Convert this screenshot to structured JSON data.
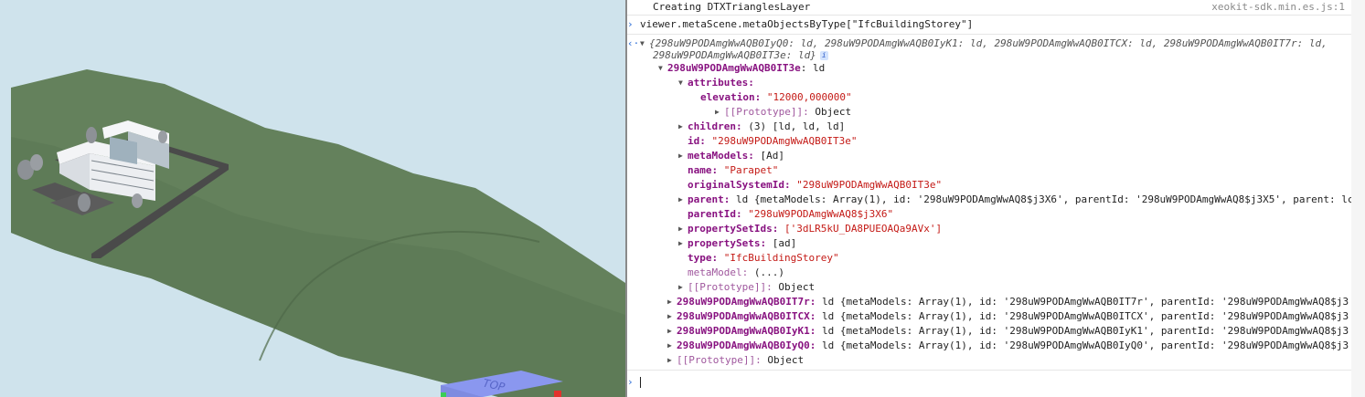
{
  "viewer": {
    "navcube_face_label": "TOP",
    "colors": {
      "sky": "#cfe3ec",
      "terrain": "#64815c",
      "road": "#4a4a4a",
      "building": "#e9ebee",
      "navcube": "#8a97ef"
    }
  },
  "console": {
    "lines": {
      "l0": "Creating DTXTrianglesLayer",
      "l0_src": "xeokit-sdk.min.es.js:1",
      "l1": "viewer.metaScene.metaObjectsByType[\"IfcBuildingStorey\"]",
      "l2a": "{298uW9PODAmgWwAQB0IyQ0: ld, 298uW9PODAmgWwAQB0IyK1: ld, 298uW9PODAmgWwAQB0ITCX: ld, 298uW9PODAmgWwAQB0IT7r: ld,",
      "l2b": "298uW9PODAmgWwAQB0IT3e: ld}",
      "badge": "i",
      "l3_key": "298uW9PODAmgWwAQB0IT3e",
      "l3_val": ": ld",
      "attributes": "attributes:",
      "elevation_key": "elevation:",
      "elevation_val": "\"12000,000000\"",
      "proto1_key": "[[Prototype]]:",
      "proto1_val": " Object",
      "children_key": "children:",
      "children_val": " (3) [ld, ld, ld]",
      "id_key": "id:",
      "id_val": " \"298uW9PODAmgWwAQB0IT3e\"",
      "metaModels_key": "metaModels:",
      "metaModels_val": " [Ad]",
      "name_key": "name:",
      "name_val": " \"Parapet\"",
      "osid_key": "originalSystemId:",
      "osid_val": " \"298uW9PODAmgWwAQB0IT3e\"",
      "parent_key": "parent:",
      "parent_val": " ld {metaModels: Array(1), id: '298uW9PODAmgWwAQ8$j3X6', parentId: '298uW9PODAmgWwAQ8$j3X5', parent: lc",
      "parentId_key": "parentId:",
      "parentId_val": " \"298uW9PODAmgWwAQ8$j3X6\"",
      "psIds_key": "propertySetIds:",
      "psIds_val": " ['3dLR5kU_DA8PUEOAQa9AVx']",
      "ps_key": "propertySets:",
      "ps_val": " [ad]",
      "type_key": "type:",
      "type_val": " \"IfcBuildingStorey\"",
      "metaModel_key": "metaModel:",
      "metaModel_val": " (...)",
      "proto2_key": "[[Prototype]]:",
      "proto2_val": " Object",
      "r1_key": "298uW9PODAmgWwAQB0IT7r:",
      "r1_val": " ld {metaModels: Array(1), id: '298uW9PODAmgWwAQB0IT7r', parentId: '298uW9PODAmgWwAQ8$j3",
      "r2_key": "298uW9PODAmgWwAQB0ITCX:",
      "r2_val": " ld {metaModels: Array(1), id: '298uW9PODAmgWwAQB0ITCX', parentId: '298uW9PODAmgWwAQ8$j3",
      "r3_key": "298uW9PODAmgWwAQB0IyK1:",
      "r3_val": " ld {metaModels: Array(1), id: '298uW9PODAmgWwAQB0IyK1', parentId: '298uW9PODAmgWwAQ8$j3",
      "r4_key": "298uW9PODAmgWwAQB0IyQ0:",
      "r4_val": " ld {metaModels: Array(1), id: '298uW9PODAmgWwAQB0IyQ0', parentId: '298uW9PODAmgWwAQ8$j3",
      "proto3_key": "[[Prototype]]:",
      "proto3_val": " Object"
    }
  }
}
